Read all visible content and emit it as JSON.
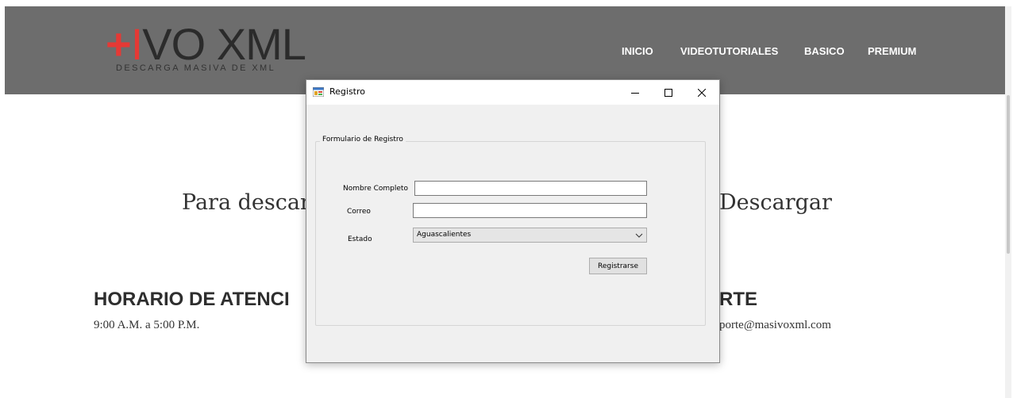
{
  "site": {
    "logo": {
      "plus": "+",
      "i": "I",
      "rest": "VO XML",
      "tagline": "DESCARGA MASIVA DE XML"
    },
    "nav": {
      "items": [
        "INICIO",
        "VIDEOTUTORIALES",
        "BASICO",
        "PREMIUM"
      ]
    },
    "headline_left": "Para descar",
    "headline_right": "Descargar",
    "hours": {
      "title": "HORARIO DE ATENCI",
      "text": "9:00 A.M. a 5:00 P.M."
    },
    "support": {
      "title": "RTE",
      "text": "porte@masivoxml.com"
    }
  },
  "dialog": {
    "title": "Registro",
    "group_title": "Formulario de Registro",
    "fields": {
      "nombre_label": "Nombre Completo",
      "nombre_value": "",
      "correo_label": "Correo",
      "correo_value": "",
      "estado_label": "Estado",
      "estado_value": "Aguascalientes"
    },
    "register_button": "Registrarse"
  },
  "colors": {
    "header_bg": "#6d6d6d",
    "logo_red": "#e53935",
    "dialog_bg": "#f0f0f0"
  }
}
